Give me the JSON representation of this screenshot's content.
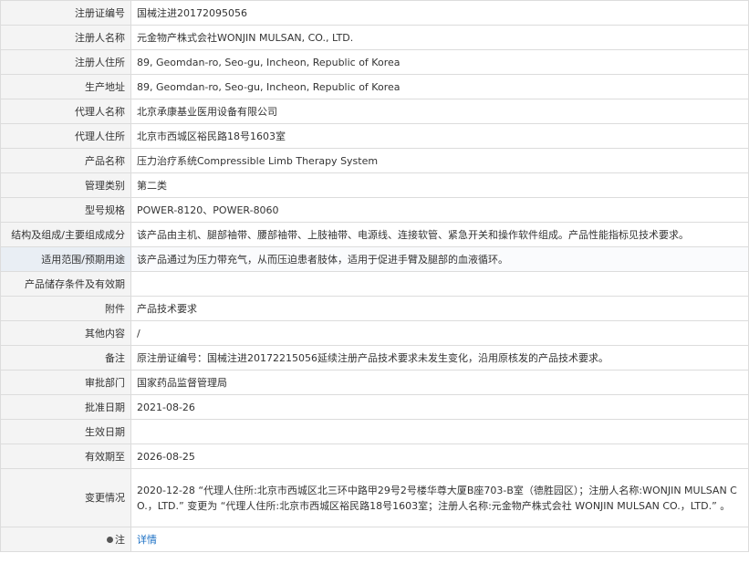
{
  "rows": [
    {
      "label": "注册证编号",
      "value": "国械注进20172095056"
    },
    {
      "label": "注册人名称",
      "value": "元金物产株式会社WONJIN MULSAN, CO., LTD."
    },
    {
      "label": "注册人住所",
      "value": "89, Geomdan-ro, Seo-gu, Incheon, Republic of Korea"
    },
    {
      "label": "生产地址",
      "value": "89, Geomdan-ro, Seo-gu, Incheon, Republic of Korea"
    },
    {
      "label": "代理人名称",
      "value": "北京承康基业医用设备有限公司"
    },
    {
      "label": "代理人住所",
      "value": "北京市西城区裕民路18号1603室"
    },
    {
      "label": "产品名称",
      "value": "压力治疗系统Compressible Limb Therapy System"
    },
    {
      "label": "管理类别",
      "value": "第二类"
    },
    {
      "label": "型号规格",
      "value": "POWER-8120、POWER-8060"
    },
    {
      "label": "结构及组成/主要组成成分",
      "value": "该产品由主机、腿部袖带、腰部袖带、上肢袖带、电源线、连接软管、紧急开关和操作软件组成。产品性能指标见技术要求。"
    },
    {
      "label": "适用范围/预期用途",
      "value": "该产品通过为压力带充气，从而压迫患者肢体，适用于促进手臂及腿部的血液循环。"
    },
    {
      "label": "产品储存条件及有效期",
      "value": ""
    },
    {
      "label": "附件",
      "value": "产品技术要求"
    },
    {
      "label": "其他内容",
      "value": "/"
    },
    {
      "label": "备注",
      "value": "原注册证编号：国械注进20172215056延续注册产品技术要求未发生变化，沿用原核发的产品技术要求。"
    },
    {
      "label": "审批部门",
      "value": "国家药品监督管理局"
    },
    {
      "label": "批准日期",
      "value": "2021-08-26"
    },
    {
      "label": "生效日期",
      "value": ""
    },
    {
      "label": "有效期至",
      "value": "2026-08-25"
    },
    {
      "label": "变更情况",
      "value": "2020-12-28 “代理人住所:北京市西城区北三环中路甲29号2号楼华尊大厦B座703-B室（德胜园区）；注册人名称:WONJIN MULSAN CO.，LTD.” 变更为 “代理人住所:北京市西城区裕民路18号1603室；注册人名称:元金物产株式会社 WONJIN MULSAN CO.，LTD.” 。"
    }
  ],
  "note": {
    "label": "注",
    "link_text": "详情",
    "icon": "pin-icon"
  }
}
